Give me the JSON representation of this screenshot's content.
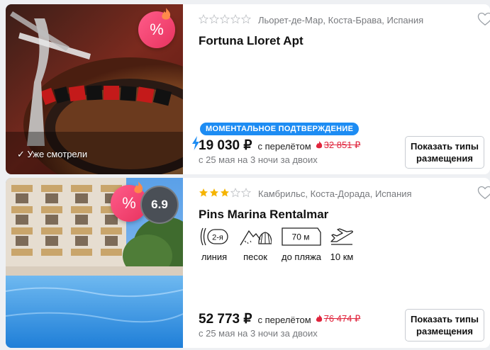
{
  "cards": [
    {
      "location": "Льорет-де-Мар, Коста-Брава, Испания",
      "name": "Fortuna Lloret Apt",
      "stars": 0,
      "badge_discount": "%",
      "seen_label": "✓ Уже смотрели",
      "instant_label": "МОМЕНТАЛЬНОЕ ПОДТВЕРЖДЕНИЕ",
      "price": "19 030 ₽",
      "with_flight": "с перелётом",
      "old_price": "32 851 ₽",
      "dates": "с 25 мая на 3 ночи за двоих",
      "button": "Показать типы размещения"
    },
    {
      "location": "Камбрильс, Коста-Дорада, Испания",
      "name": "Pins Marina Rentalmar",
      "stars": 3,
      "badge_discount": "%",
      "rating": "6.9",
      "features": {
        "line_value": "2-я",
        "line_label": "линия",
        "beach_label": "песок",
        "distance_value": "70 м",
        "distance_label": "до пляжа",
        "airport_label": "10 км"
      },
      "price": "52 773 ₽",
      "with_flight": "с перелётом",
      "old_price": "76 474 ₽",
      "dates": "с 25 мая на 3 ночи за двоих",
      "button": "Показать типы размещения"
    }
  ],
  "colors": {
    "accent": "#1d8cf3",
    "discount": "#e8335f",
    "old_price": "#e0243c",
    "star": "#f5b400"
  }
}
